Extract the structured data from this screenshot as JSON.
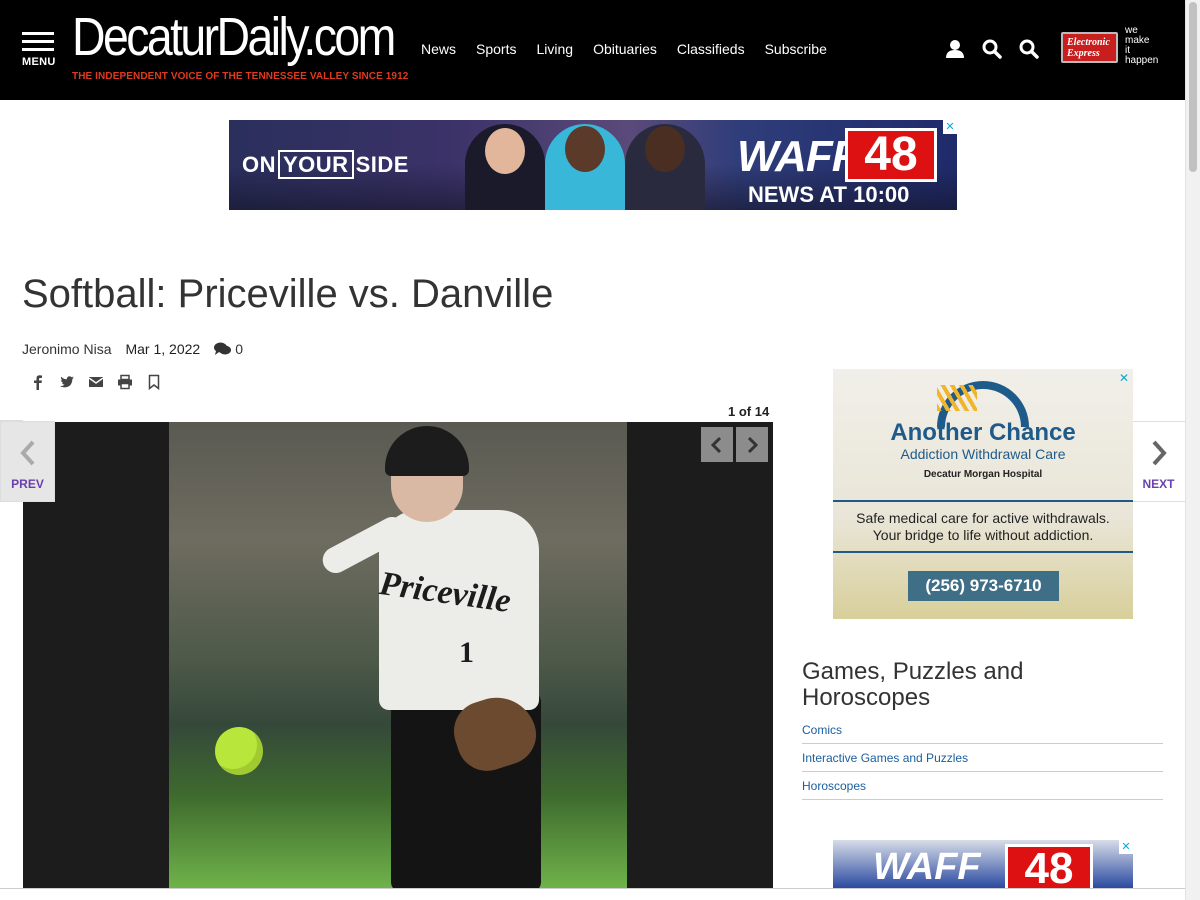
{
  "header": {
    "menu_label": "MENU",
    "logo_text": "DecaturDaily.com",
    "tagline": "THE INDEPENDENT VOICE OF THE TENNESSEE VALLEY SINCE 1912",
    "nav": [
      "News",
      "Sports",
      "Living",
      "Obituaries",
      "Classifieds",
      "Subscribe"
    ],
    "icons": [
      "user-icon",
      "search-icon",
      "search-icon"
    ],
    "sponsor_logo": "Electronic Express",
    "sponsor_tag": [
      "we",
      "make",
      "it",
      "happen"
    ]
  },
  "top_ad": {
    "slogan_pre": "ON",
    "slogan_box": "YOUR",
    "slogan_post": "SIDE",
    "station": "WAFF",
    "channel": "48",
    "newscast": "NEWS AT 10:00",
    "close": "✕"
  },
  "article": {
    "headline": "Softball: Priceville vs. Danville",
    "author": "Jeronimo Nisa",
    "date": "Mar 1, 2022",
    "comment_count": "0",
    "share_icons": [
      "facebook-icon",
      "twitter-icon",
      "email-icon",
      "print-icon",
      "bookmark-icon"
    ]
  },
  "gallery": {
    "counter": "1 of 14",
    "jersey_name": "Priceville",
    "jersey_number": "1",
    "prev_label": "PREV",
    "next_label": "NEXT"
  },
  "right_ad": {
    "title": "Another Chance",
    "subtitle": "Addiction Withdrawal Care",
    "hospital": "Decatur Morgan Hospital",
    "line1": "Safe medical care for active withdrawals.",
    "line2": "Your bridge to life without addiction.",
    "phone": "(256) 973-6710",
    "close": "✕"
  },
  "games": {
    "title": "Games, Puzzles and Horoscopes",
    "links": [
      "Comics",
      "Interactive Games and Puzzles",
      "Horoscopes"
    ]
  },
  "bottom_ad": {
    "station": "WAFF",
    "channel": "48",
    "close": "✕"
  },
  "colors": {
    "header_bg": "#000000",
    "tagline": "#e03a1e",
    "accent_purple": "#6a3fb0",
    "link_blue": "#1a5fa0",
    "ad_blue": "#1f5b8a"
  }
}
